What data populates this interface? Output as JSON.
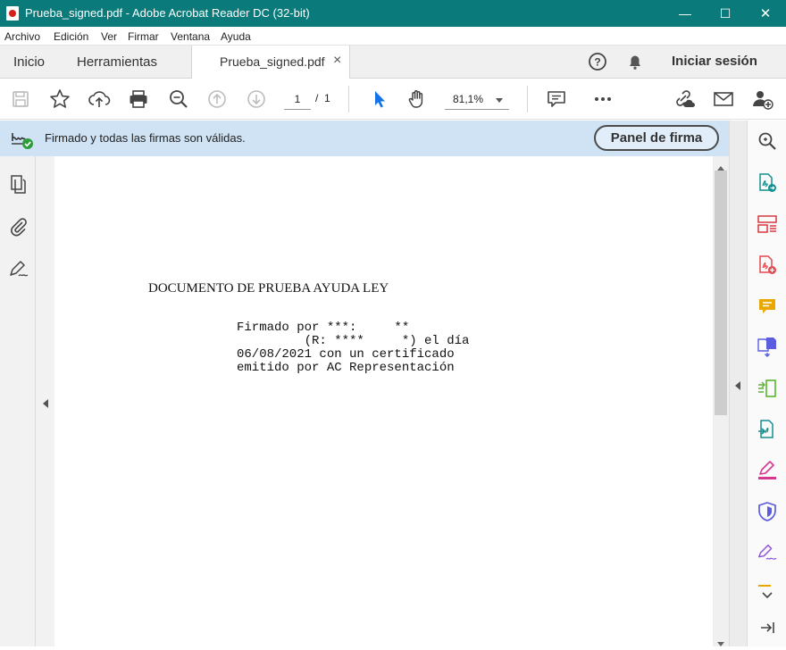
{
  "window": {
    "title": "Prueba_signed.pdf - Adobe Acrobat Reader DC (32-bit)",
    "minimize": "—",
    "maximize": "☐",
    "close": "✕"
  },
  "menu": [
    "Archivo",
    "Edición",
    "Ver",
    "Firmar",
    "Ventana",
    "Ayuda"
  ],
  "tabs": {
    "home": "Inicio",
    "tools": "Herramientas",
    "document": "Prueba_signed.pdf",
    "document_close": "×",
    "signin": "Iniciar sesión"
  },
  "toolbar": {
    "page_current": "1",
    "page_total": "/  1",
    "zoom": "81,1%"
  },
  "signature_bar": {
    "message": "Firmado y todas las firmas son válidas.",
    "panel_button": "Panel de firma"
  },
  "document": {
    "heading": "DOCUMENTO DE PRUEBA AYUDA LEY",
    "lines": [
      "Firmado por ***:     **",
      "         (R: ****     *) el día",
      "06/08/2021 con un certificado",
      "emitido por AC Representación"
    ]
  },
  "colors": {
    "titlebar": "#0a7a7a",
    "sigbar": "#cfe3f4",
    "accent_blue": "#1473e6"
  }
}
